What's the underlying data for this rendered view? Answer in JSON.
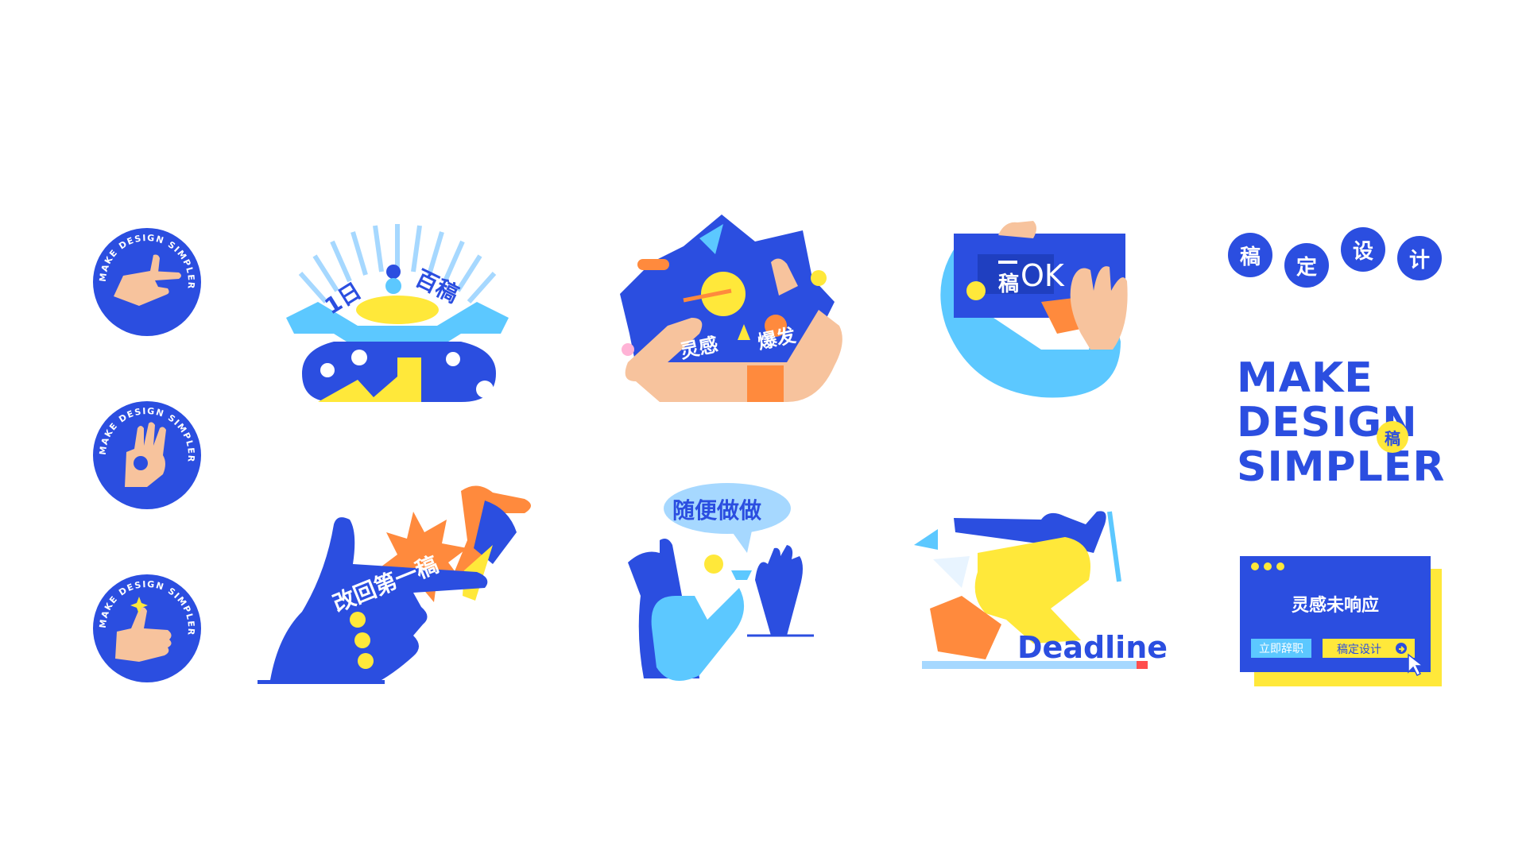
{
  "badge_ring_text": "MAKE DESIGN SIMPLER ",
  "stickers": {
    "hundred_drafts": {
      "left": "1日",
      "right": "百稿"
    },
    "inspiration": {
      "left": "灵感",
      "right": "爆发"
    },
    "ok": {
      "gao": "稿",
      "ok": "OK"
    },
    "revert": {
      "text": "改回第一稿"
    },
    "casual": {
      "bubble": "随便做做"
    },
    "deadline": {
      "text": "Deadline"
    }
  },
  "brand": {
    "circles": [
      "稿",
      "定",
      "设",
      "计"
    ],
    "slogan": [
      "MAKE",
      "DESIGN",
      "SIMPLER"
    ],
    "slogan_stamp": "稿"
  },
  "dialog": {
    "message": "灵感未响应",
    "resign": "立即辞职",
    "confirm": "稿定设计"
  },
  "colors": {
    "blue": "#2b4ee0",
    "light_blue": "#5cc8ff",
    "yellow": "#ffe83a",
    "skin": "#f7c39d",
    "orange": "#ff8a3d"
  }
}
